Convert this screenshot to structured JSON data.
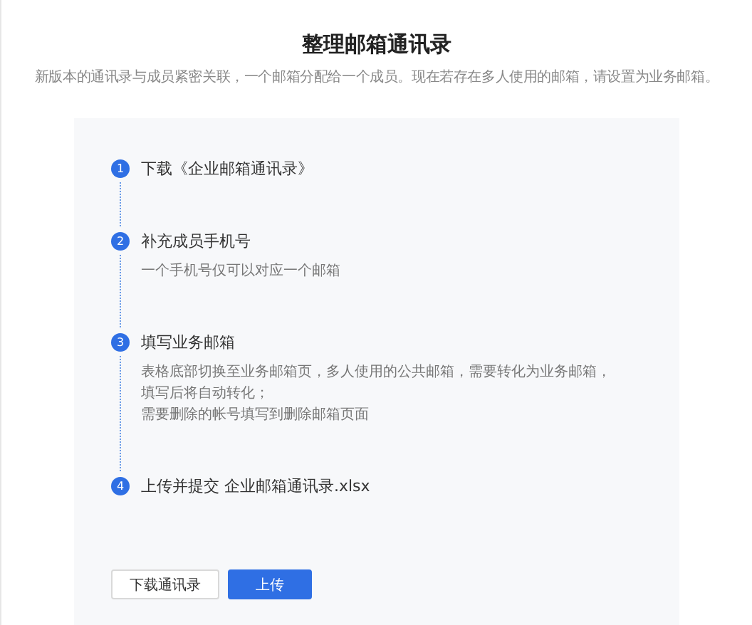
{
  "title": "整理邮箱通讯录",
  "subtitle": "新版本的通讯录与成员紧密关联，一个邮箱分配给一个成员。现在若存在多人使用的邮箱，请设置为业务邮箱。",
  "steps": [
    {
      "number": "1",
      "title": "下载《企业邮箱通讯录》"
    },
    {
      "number": "2",
      "title": "补充成员手机号",
      "description": [
        "一个手机号仅可以对应一个邮箱"
      ]
    },
    {
      "number": "3",
      "title": "填写业务邮箱",
      "description": [
        "表格底部切换至业务邮箱页，多人使用的公共邮箱，需要转化为业务邮箱，",
        "填写后将自动转化；",
        "需要删除的帐号填写到删除邮箱页面"
      ]
    },
    {
      "number": "4",
      "title": "上传并提交 企业邮箱通讯录.xlsx"
    }
  ],
  "buttons": [
    {
      "label": "下载通讯录",
      "kind": "secondary"
    },
    {
      "label": "上传",
      "kind": "primary"
    }
  ]
}
